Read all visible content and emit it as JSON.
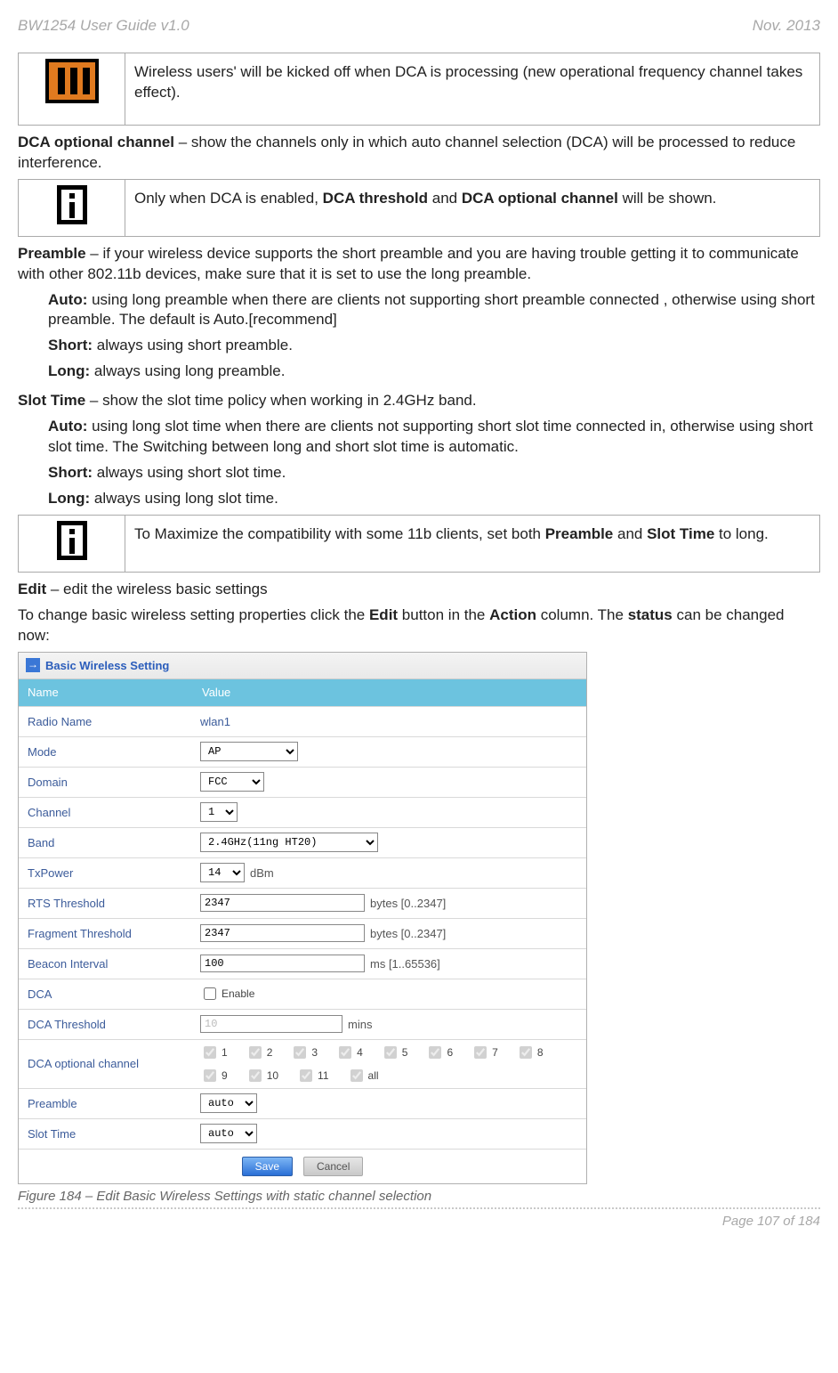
{
  "header": {
    "left": "BW1254 User Guide v1.0",
    "right": "Nov.  2013"
  },
  "note1": "Wireless users' will be kicked off when DCA is processing (new operational frequency channel takes effect).",
  "p_dca_opt_b": "DCA optional channel",
  "p_dca_opt": " – show the channels only in which auto channel selection (DCA) will be processed to reduce interference.",
  "note2a": "Only when DCA is enabled, ",
  "note2b": "DCA threshold",
  "note2c": " and ",
  "note2d": "DCA optional channel",
  "note2e": " will be shown.",
  "pre_b": "Preamble",
  "pre_t": " – if your wireless device supports the short preamble and you are having trouble getting it to communicate with other 802.11b devices, make sure that it is set to use the long preamble.",
  "pre_auto_b": "Auto:",
  "pre_auto_t": " using long preamble when there are clients not supporting short preamble connected , otherwise using short preamble. The default is Auto.[recommend]",
  "pre_short_b": "Short:",
  "pre_short_t": " always using short preamble.",
  "pre_long_b": "Long:",
  "pre_long_t": " always using long preamble.",
  "slot_hb": "Slot Time",
  "slot_ht": " – show the slot time policy when working in 2.4GHz band.",
  "slot_auto_b": "Auto:",
  "slot_auto_t": " using long slot time when there are clients not supporting short slot time connected in, otherwise using short slot time. The Switching between long and short slot time is automatic.",
  "slot_short_b": "Short:",
  "slot_short_t": " always using short slot time.",
  "slot_long_b": "Long:",
  "slot_long_t": " always using long slot time.",
  "note3a": "To Maximize the compatibility with some 11b clients, set both ",
  "note3b": "Preamble",
  "note3c": " and ",
  "note3d": "Slot Time",
  "note3e": " to long.",
  "edit_b": "Edit",
  "edit_t": " – edit the wireless basic settings",
  "change_a": "To change basic wireless setting properties click the ",
  "change_b": "Edit",
  "change_c": " button in the ",
  "change_d": "Action",
  "change_e": " column. The ",
  "change_f": "status",
  "change_g": " can be changed now:",
  "sc": {
    "title": "Basic Wireless Setting",
    "col_name": "Name",
    "col_value": "Value",
    "rows": {
      "radio": {
        "label": "Radio Name",
        "value": "wlan1"
      },
      "mode": {
        "label": "Mode",
        "value": "AP"
      },
      "domain": {
        "label": "Domain",
        "value": "FCC"
      },
      "channel": {
        "label": "Channel",
        "value": "1"
      },
      "band": {
        "label": "Band",
        "value": "2.4GHz(11ng HT20)"
      },
      "txpower": {
        "label": "TxPower",
        "value": "14",
        "unit": "dBm"
      },
      "rts": {
        "label": "RTS Threshold",
        "value": "2347",
        "unit": "bytes [0..2347]"
      },
      "frag": {
        "label": "Fragment Threshold",
        "value": "2347",
        "unit": "bytes [0..2347]"
      },
      "beacon": {
        "label": "Beacon Interval",
        "value": "100",
        "unit": "ms [1..65536]"
      },
      "dca": {
        "label": "DCA",
        "enable": "Enable"
      },
      "dcath": {
        "label": "DCA Threshold",
        "value": "10",
        "unit": "mins"
      },
      "dcaopt": {
        "label": "DCA optional channel",
        "opts": [
          "1",
          "2",
          "3",
          "4",
          "5",
          "6",
          "7",
          "8",
          "9",
          "10",
          "11",
          "all"
        ]
      },
      "preamble": {
        "label": "Preamble",
        "value": "auto"
      },
      "slot": {
        "label": "Slot Time",
        "value": "auto"
      }
    },
    "save": "Save",
    "cancel": "Cancel"
  },
  "fig_caption": "Figure 184 – Edit Basic Wireless Settings with static channel selection",
  "footer": "Page 107 of 184"
}
